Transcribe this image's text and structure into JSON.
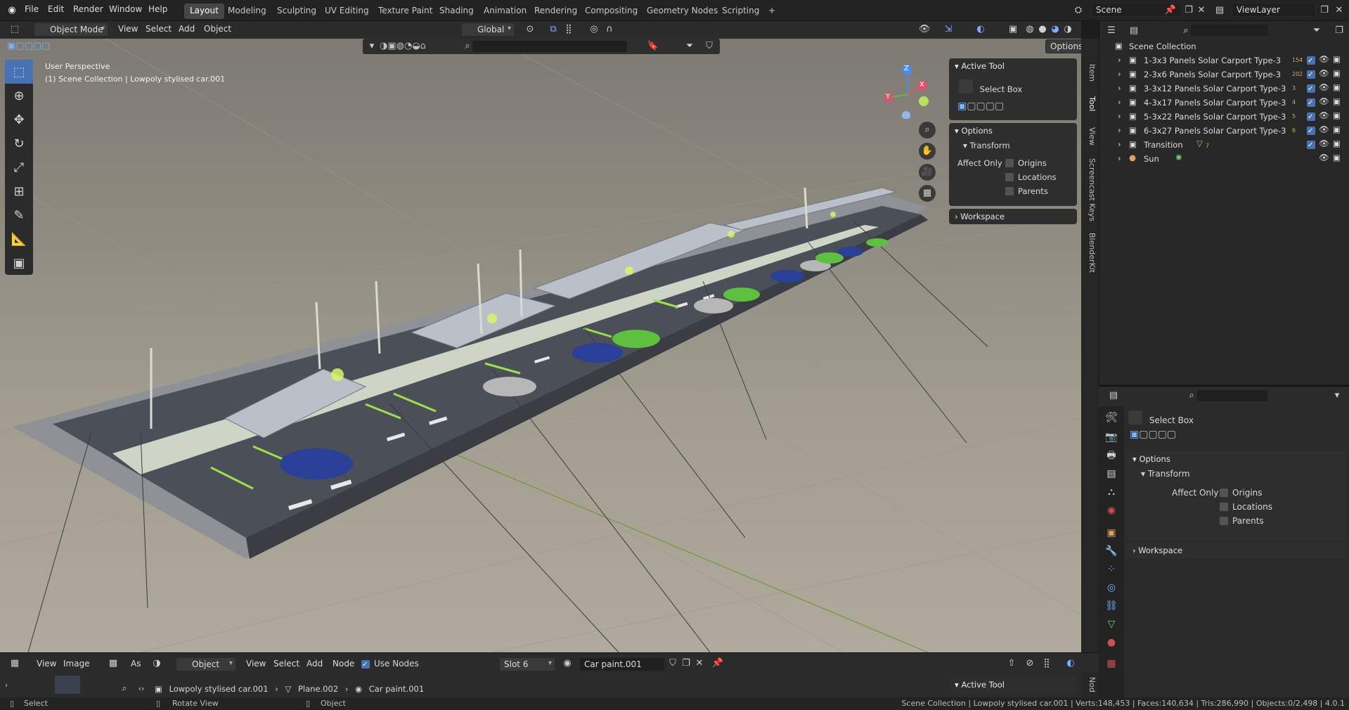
{
  "topbar": {
    "menus": [
      "File",
      "Edit",
      "Render",
      "Window",
      "Help"
    ],
    "workspaces": [
      "Layout",
      "Modeling",
      "Sculpting",
      "UV Editing",
      "Texture Paint",
      "Shading",
      "Animation",
      "Rendering",
      "Compositing",
      "Geometry Nodes",
      "Scripting"
    ],
    "active_workspace": "Layout",
    "add_tab": "+",
    "scene": "Scene",
    "view_layer": "ViewLayer"
  },
  "header": {
    "mode": "Object Mode",
    "menus": [
      "View",
      "Select",
      "Add",
      "Object"
    ],
    "orientation": "Global",
    "options": "Options"
  },
  "viewport": {
    "perspective": "User Perspective",
    "collection_info": "(1) Scene Collection | Lowpoly stylised car.001",
    "gizmo": {
      "z": "Z",
      "y": "Y",
      "x": "X"
    }
  },
  "npanel": {
    "active_tool_title": "Active Tool",
    "tool_name": "Select Box",
    "options_title": "Options",
    "transform_title": "Transform",
    "affect_only": "Affect Only",
    "origins": "Origins",
    "locations": "Locations",
    "parents": "Parents",
    "workspace": "Workspace",
    "tabs": [
      "Item",
      "Tool",
      "View",
      "Screencast Keys",
      "BlenderKit"
    ]
  },
  "outliner": {
    "root": "Scene Collection",
    "items": [
      {
        "label": "1-3x3 Panels Solar Carport Type-3",
        "badge": "154"
      },
      {
        "label": "2-3x6 Panels Solar Carport Type-3",
        "badge": "202"
      },
      {
        "label": "3-3x12 Panels Solar Carport Type-3",
        "badge": "3"
      },
      {
        "label": "4-3x17 Panels Solar Carport Type-3",
        "badge": "4"
      },
      {
        "label": "5-3x22 Panels Solar Carport Type-3",
        "badge": "5"
      },
      {
        "label": "6-3x27 Panels Solar Carport Type-3",
        "badge": "6"
      },
      {
        "label": "Transition",
        "badge": "7"
      },
      {
        "label": "Sun",
        "badge": ""
      }
    ]
  },
  "properties": {
    "tool_name": "Select Box",
    "options": "Options",
    "transform": "Transform",
    "affect_only": "Affect Only",
    "origins": "Origins",
    "locations": "Locations",
    "parents": "Parents",
    "workspace": "Workspace"
  },
  "bottom_editor": {
    "view": "View",
    "image": "Image",
    "as": "As",
    "object": "Object",
    "menus": [
      "View",
      "Select",
      "Add",
      "Node"
    ],
    "use_nodes": "Use Nodes",
    "slot": "Slot 6",
    "material": "Car paint.001",
    "breadcrumb_object": "Lowpoly stylised car.001",
    "breadcrumb_mesh": "Plane.002",
    "breadcrumb_material": "Car paint.001",
    "active_tool": "Active Tool",
    "side_tab": "Nod"
  },
  "statusbar": {
    "select": "Select",
    "rotate": "Rotate View",
    "object": "Object",
    "stats": "Scene Collection | Lowpoly stylised car.001 | Verts:148,453 | Faces:140,634 | Tris:286,990 | Objects:0/2,498 | 4.0.1"
  },
  "colors": {
    "accent": "#4772b3",
    "header": "#2b2b2b",
    "panel": "#2e2e2e"
  }
}
